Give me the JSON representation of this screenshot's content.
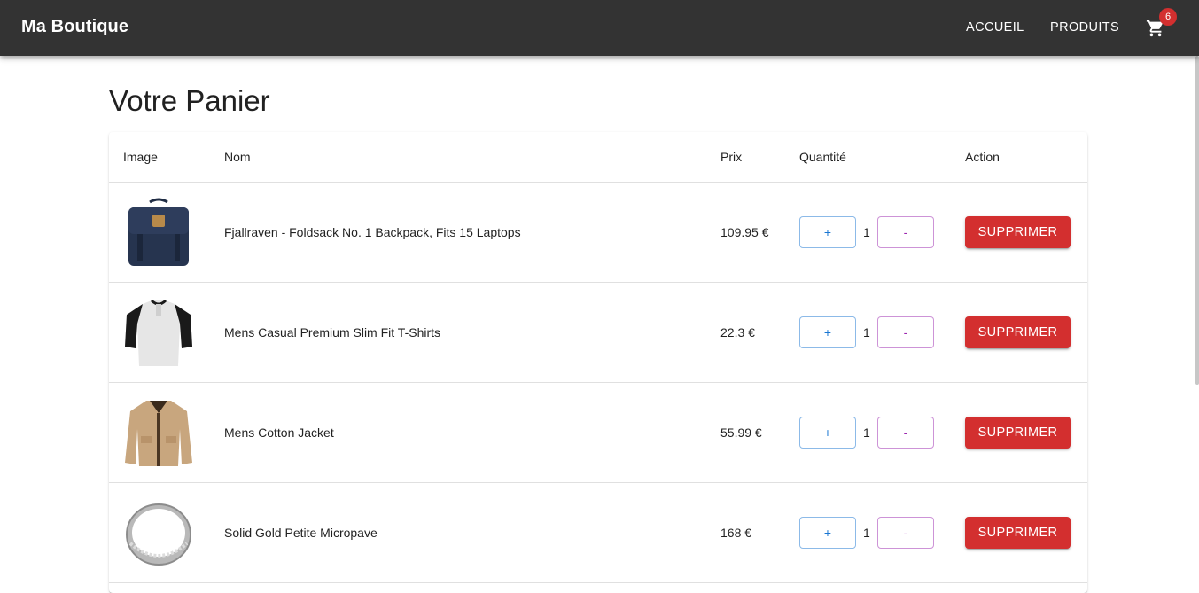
{
  "header": {
    "brand": "Ma Boutique",
    "nav": [
      "ACCUEIL",
      "PRODUITS"
    ],
    "cart_icon": "cart-icon",
    "cart_count": "6"
  },
  "page": {
    "title": "Votre Panier"
  },
  "table": {
    "columns": [
      "Image",
      "Nom",
      "Prix",
      "Quantité",
      "Action"
    ],
    "rows": [
      {
        "image": "backpack-image",
        "name": "Fjallraven - Foldsack No. 1 Backpack, Fits 15 Laptops",
        "price": "109.95 €",
        "qty": "1",
        "plus": "+",
        "minus": "-",
        "action": "SUPPRIMER"
      },
      {
        "image": "tshirt-image",
        "name": "Mens Casual Premium Slim Fit T-Shirts",
        "price": "22.3 €",
        "qty": "1",
        "plus": "+",
        "minus": "-",
        "action": "SUPPRIMER"
      },
      {
        "image": "jacket-image",
        "name": "Mens Cotton Jacket",
        "price": "55.99 €",
        "qty": "1",
        "plus": "+",
        "minus": "-",
        "action": "SUPPRIMER"
      },
      {
        "image": "ring-image",
        "name": "Solid Gold Petite Micropave",
        "price": "168 €",
        "qty": "1",
        "plus": "+",
        "minus": "-",
        "action": "SUPPRIMER"
      }
    ]
  },
  "colors": {
    "appbar": "#333333",
    "danger": "#d32f2f",
    "primary": "#1976d2",
    "secondary": "#9c27b0"
  }
}
